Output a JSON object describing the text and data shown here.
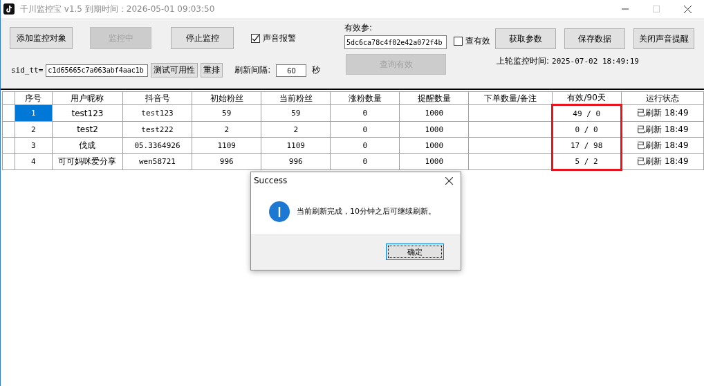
{
  "window": {
    "title": "千川监控宝 v1.5  到期时间：2026-05-01 09:03:50"
  },
  "toolbar": {
    "add_button": {
      "label": "添加监控对象",
      "disabled": false
    },
    "monitoring_button": {
      "label": "监控中",
      "disabled": true
    },
    "stop_button": {
      "label": "停止监控",
      "disabled": false
    },
    "sound_alarm": {
      "label": "声音报警",
      "checked": true
    },
    "sid_label": "sid_tt=",
    "sid_value": "c1d65665c7a063abf4aac1b",
    "test_button": {
      "label": "测试可用性",
      "disabled": false
    },
    "reorder_button": {
      "label": "重排",
      "disabled": false
    },
    "interval_label": "刷新间隔:",
    "interval_value": "60",
    "interval_unit": "秒",
    "param_label": "有效参:",
    "param_value": "5dc6ca78c4f02e42a072f4b",
    "check_valid": {
      "label": "查有效",
      "checked": false
    },
    "query_button": {
      "label": "查询有效",
      "disabled": true
    },
    "get_params_button": {
      "label": "获取参数",
      "disabled": false
    },
    "save_button": {
      "label": "保存数据",
      "disabled": false
    },
    "mute_button": {
      "label": "关闭声音提醒",
      "disabled": false
    },
    "last_time_label": "上轮监控时间:",
    "last_time_value": "2025-07-02 18:49:19"
  },
  "table": {
    "columns": [
      {
        "label": "序号",
        "highlighted": false
      },
      {
        "label": "用户昵称",
        "highlighted": false
      },
      {
        "label": "抖音号",
        "highlighted": false
      },
      {
        "label": "初始粉丝",
        "highlighted": false
      },
      {
        "label": "当前粉丝",
        "highlighted": false
      },
      {
        "label": "涨粉数量",
        "highlighted": false
      },
      {
        "label": "提醒数量",
        "highlighted": false
      },
      {
        "label": "下单数量/备注",
        "highlighted": false
      },
      {
        "label": "有效/90天",
        "highlighted": true
      },
      {
        "label": "运行状态",
        "highlighted": false
      }
    ],
    "rows": [
      {
        "selected": true,
        "cells": [
          "1",
          "test123",
          "test123",
          "59",
          "59",
          "0",
          "1000",
          "",
          "49 / 0",
          "已刷新 18:49"
        ]
      },
      {
        "selected": false,
        "cells": [
          "2",
          "test2",
          "test222",
          "2",
          "2",
          "0",
          "1000",
          "",
          "0 / 0",
          "已刷新 18:49"
        ]
      },
      {
        "selected": false,
        "cells": [
          "3",
          "伐成",
          "05.3364926",
          "1109",
          "1109",
          "0",
          "1000",
          "",
          "17 / 98",
          "已刷新 18:49"
        ]
      },
      {
        "selected": false,
        "cells": [
          "4",
          "可可妈咪爱分享",
          "wen58721",
          "996",
          "996",
          "0",
          "1000",
          "",
          "5 / 2",
          "已刷新 18:49"
        ]
      }
    ]
  },
  "dialog": {
    "title": "Success",
    "message": "当前刷新完成，10分钟之后可继续刷新。",
    "ok_button": "确定"
  }
}
